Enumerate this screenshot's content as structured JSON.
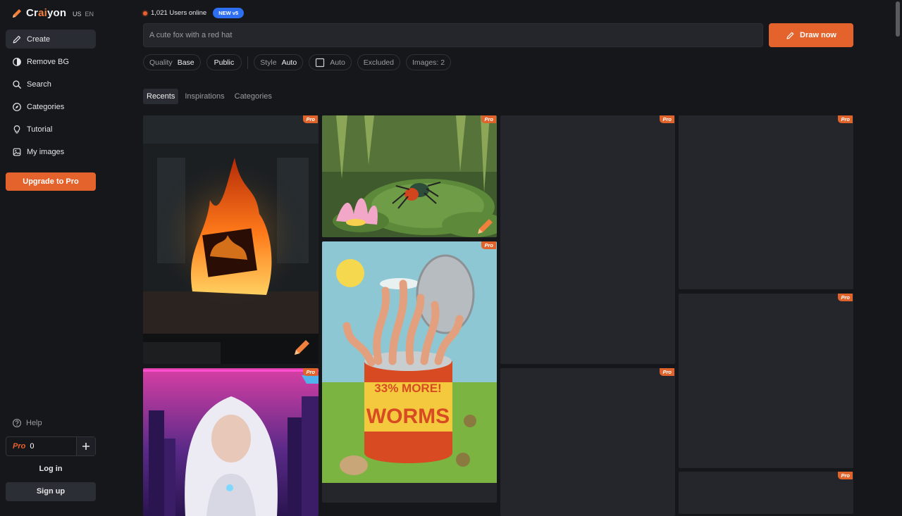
{
  "brand": {
    "name_before": "Cr",
    "name_accent": "ai",
    "name_after": "yon",
    "lang_country": "US",
    "lang_code": "EN"
  },
  "sidebar": {
    "items": [
      {
        "label": "Create",
        "icon": "pencil-icon"
      },
      {
        "label": "Remove BG",
        "icon": "contrast-icon"
      },
      {
        "label": "Search",
        "icon": "search-icon"
      },
      {
        "label": "Categories",
        "icon": "compass-icon"
      },
      {
        "label": "Tutorial",
        "icon": "lightbulb-icon"
      },
      {
        "label": "My images",
        "icon": "image-icon"
      }
    ],
    "upgrade_label": "Upgrade to Pro",
    "help_label": "Help",
    "credits_label": "Pro",
    "credits_count": "0",
    "login_label": "Log in",
    "signup_label": "Sign up"
  },
  "header": {
    "online_text": "1,021 Users online",
    "new_badge": "NEW v5"
  },
  "prompt": {
    "placeholder": "A cute fox with a red hat",
    "draw_label": "Draw now"
  },
  "options": {
    "quality_label": "Quality",
    "quality_value": "Base",
    "visibility": "Public",
    "style_label": "Style",
    "style_value": "Auto",
    "aspect_value": "Auto",
    "excluded_label": "Excluded",
    "images_label": "Images: 2"
  },
  "tabs": [
    "Recents",
    "Inspirations",
    "Categories"
  ],
  "gallery": {
    "badge": "Pro",
    "canned_text_1": "33% MORE!",
    "canned_text_2": "WORMS"
  },
  "colors": {
    "accent": "#e4622b",
    "background": "#16171b",
    "card": "#24262c",
    "new_badge": "#2d6ff0"
  }
}
